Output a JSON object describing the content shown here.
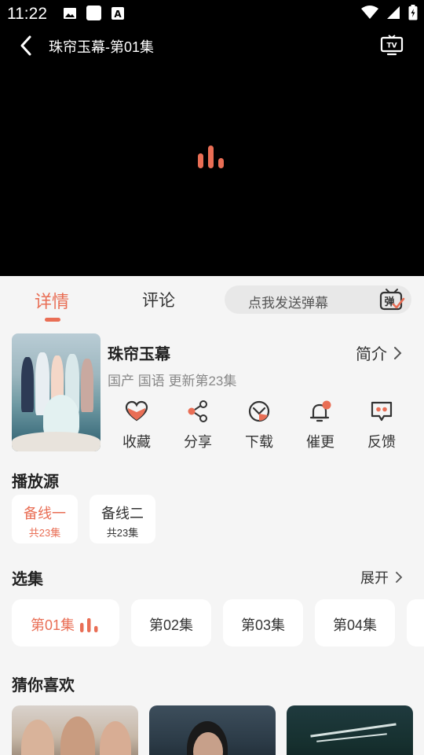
{
  "status_bar": {
    "time": "11:22"
  },
  "player": {
    "title": "珠帘玉幕-第01集"
  },
  "tabs": [
    {
      "label": "详情",
      "active": true
    },
    {
      "label": "评论",
      "active": false
    }
  ],
  "danmu": {
    "placeholder": "点我发送弹幕",
    "icon_text": "弹"
  },
  "show": {
    "title": "珠帘玉幕",
    "meta": "国产 国语 更新第23集",
    "intro_label": "简介"
  },
  "actions": [
    {
      "label": "收藏",
      "icon": "favorite-heart-icon"
    },
    {
      "label": "分享",
      "icon": "share-icon"
    },
    {
      "label": "下载",
      "icon": "download-icon"
    },
    {
      "label": "催更",
      "icon": "bell-icon"
    },
    {
      "label": "反馈",
      "icon": "feedback-icon"
    }
  ],
  "sources": {
    "title": "播放源",
    "items": [
      {
        "name": "备线一",
        "count": "共23集",
        "active": true
      },
      {
        "name": "备线二",
        "count": "共23集",
        "active": false
      }
    ]
  },
  "episodes": {
    "title": "选集",
    "expand_label": "展开",
    "items": [
      {
        "label": "第01集",
        "active": true
      },
      {
        "label": "第02集",
        "active": false
      },
      {
        "label": "第03集",
        "active": false
      },
      {
        "label": "第04集",
        "active": false
      }
    ]
  },
  "recommend": {
    "title": "猜你喜欢"
  },
  "colors": {
    "accent": "#e96e55",
    "background": "#f5f5f5",
    "card": "#ffffff"
  }
}
